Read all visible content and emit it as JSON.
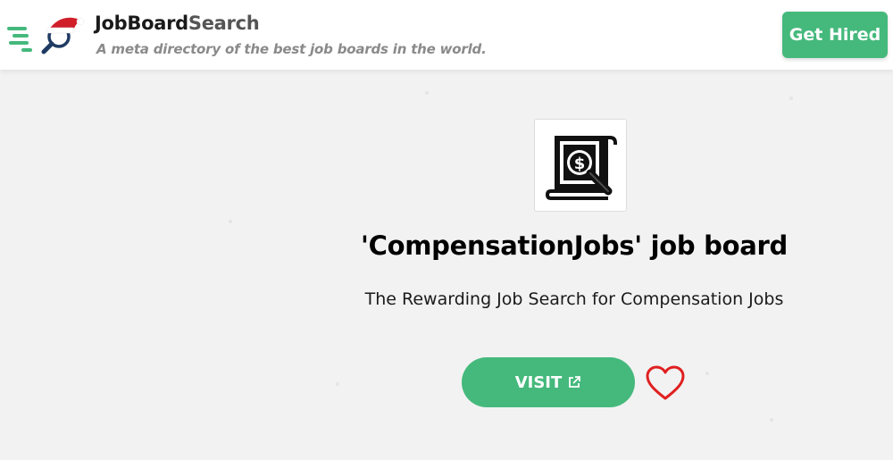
{
  "header": {
    "brand_primary": "JobBoard",
    "brand_secondary": "Search",
    "tagline": "A meta directory of the best job boards in the world.",
    "cta_label": "Get Hired",
    "logo_icon": "magnifier-speed-santa-hat-icon"
  },
  "board": {
    "logo_icon": "salary-scroll-magnifier-icon",
    "title": "'CompensationJobs' job board",
    "subtitle": "The Rewarding Job Search for Compensation Jobs",
    "visit_label": "VISIT",
    "visit_icon": "external-link-icon",
    "favorite_icon": "heart-outline-icon"
  },
  "colors": {
    "accent": "#45b97c",
    "heart": "#e02020",
    "background": "#f2f2f2",
    "header_bg": "#ffffff"
  }
}
